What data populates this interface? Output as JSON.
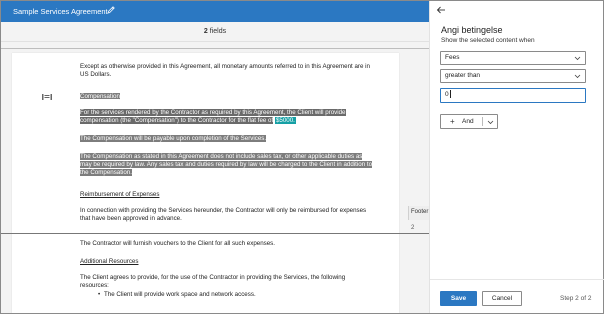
{
  "editor": {
    "document_title": "Sample Services Agreement",
    "fields_count": "2",
    "fields_label": "fields",
    "footer_label": "Footer",
    "footer_number": "2"
  },
  "document": {
    "para_currency": "Except as otherwise provided in this Agreement, all monetary amounts referred to in this Agreement are in US Dollars.",
    "heading_compensation": "Compensation",
    "para_comp_1a": "For the services rendered by the Contractor as required by this Agreement, the Client will provide",
    "para_comp_1b": "compensation (the \"Compensation\") to the Contractor for the flat fee of",
    "para_comp_amount": "$5000.",
    "para_comp_2": "The Compensation will be payable upon completion of the Services.",
    "para_comp_3a": "The Compensation as stated in this Agreement does not include sales tax, or other applicable duties as",
    "para_comp_3b": "may be required by law. Any sales tax and duties required by law will be charged to the Client in addition to",
    "para_comp_3c": "the Compensation.",
    "heading_reimbursement": "Reimbursement of Expenses",
    "para_reimb_a": "In connection with providing the Services hereunder, the Contractor will only be reimbursed for expenses",
    "para_reimb_b": "that have been approved in advance.",
    "para_vouchers": "The Contractor will furnish vouchers to the Client for all such expenses.",
    "heading_resources": "Additional Resources",
    "para_resources_a": "The Client agrees to provide, for the use of the Contractor in providing the Services, the following",
    "para_resources_b": "resources:",
    "bullet_1": "The Client will provide work space and network access."
  },
  "panel": {
    "title": "Angi betingelse",
    "subtitle": "Show the selected content when",
    "field_select": "Fees",
    "operator_select": "greater than",
    "value_input": "0",
    "add_label": "And",
    "save_label": "Save",
    "cancel_label": "Cancel",
    "step_text": "Step 2 of 2"
  },
  "colors": {
    "accent": "#2b78c2",
    "highlight": "#7d7d7d",
    "amount_highlight": "#16a0a5"
  }
}
